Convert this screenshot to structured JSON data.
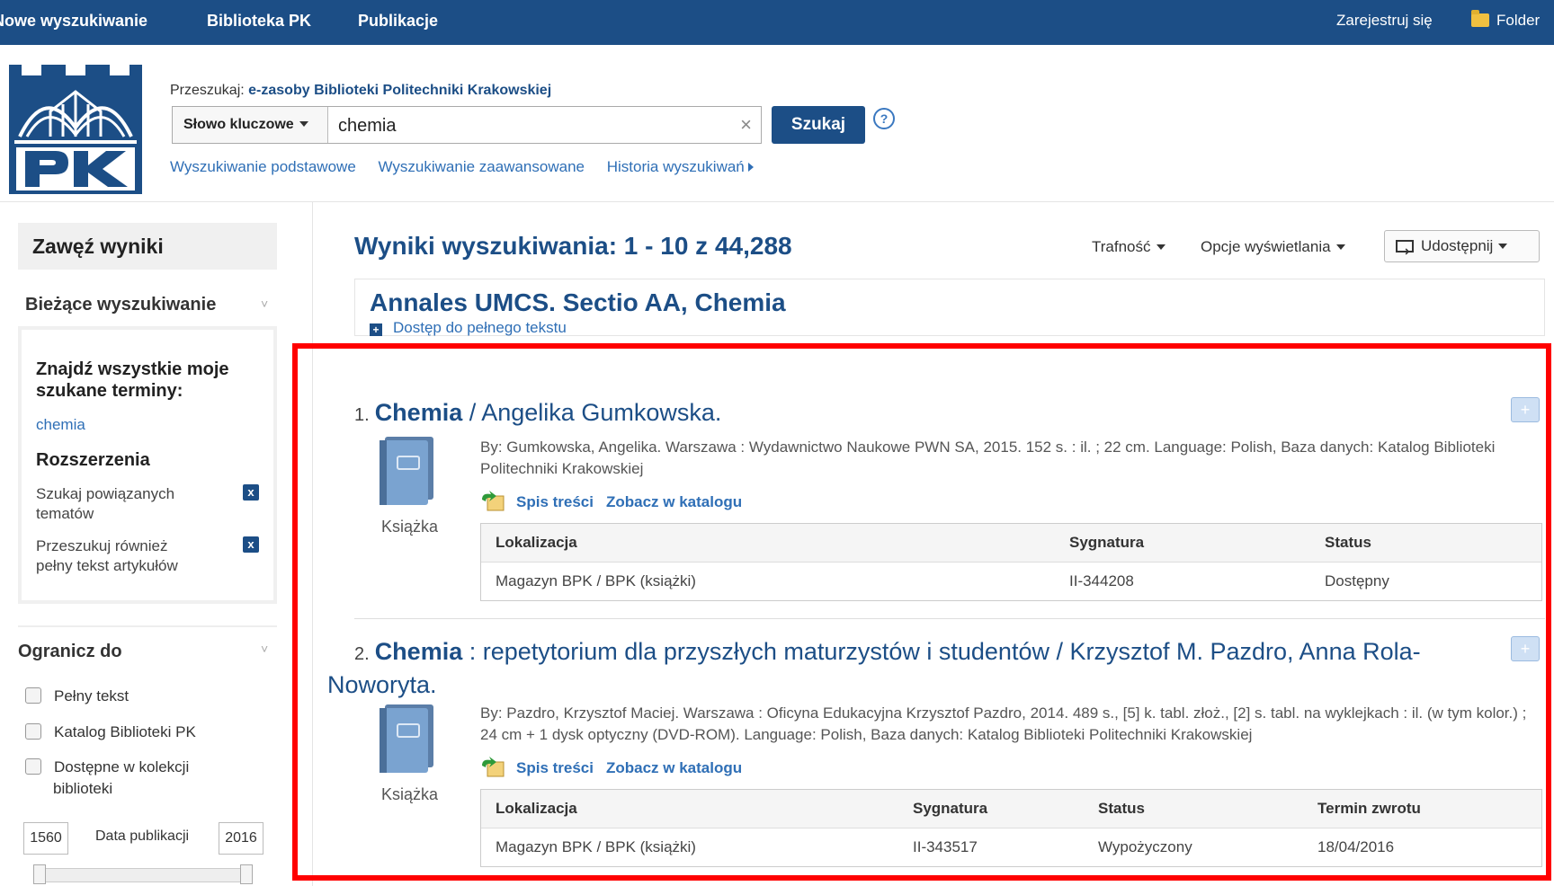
{
  "topbar": {
    "nav": [
      "Nowe wyszukiwanie",
      "Biblioteka PK",
      "Publikacje"
    ],
    "register": "Zarejestruj się",
    "folder": "Folder"
  },
  "search": {
    "label_prefix": "Przeszukaj:",
    "label_source": "e-zasoby Biblioteki Politechniki Krakowskiej",
    "field_select": "Słowo kluczowe",
    "query": "chemia",
    "clear": "×",
    "button": "Szukaj",
    "help": "?",
    "links": [
      "Wyszukiwanie podstawowe",
      "Wyszukiwanie zaawansowane",
      "Historia wyszukiwań"
    ]
  },
  "sidebar": {
    "title": "Zawęź wyniki",
    "current_title": "Bieżące wyszukiwanie",
    "find_all": "Znajdź wszystkie moje szukane terminy:",
    "term": "chemia",
    "extensions": "Rozszerzenia",
    "ext_options": [
      "Szukaj powiązanych tematów",
      "Przeszukuj również pełny tekst artykułów"
    ],
    "limit_title": "Ogranicz do",
    "limit_options": [
      "Pełny tekst",
      "Katalog Biblioteki PK",
      "Dostępne w kolekcji biblioteki"
    ],
    "date_from": "1560",
    "date_label": "Data publikacji",
    "date_to": "2016",
    "date_range_fraction": [
      0.0,
      1.0
    ]
  },
  "main": {
    "results_title": "Wyniki wyszukiwania: 1 - 10 z 44,288",
    "sort": "Trafność",
    "display_options": "Opcje wyświetlania",
    "share": "Udostępnij",
    "pub": {
      "title": "Annales UMCS. Sectio AA, Chemia",
      "link": "Dostęp do pełnego tekstu"
    },
    "results": [
      {
        "num": "1.",
        "title_strong": "Chemia",
        "title_rest": " / Angelika Gumkowska.",
        "type": "Książka",
        "desc": "By: Gumkowska, Angelika. Warszawa : Wydawnictwo Naukowe PWN SA, 2015. 152 s. : il. ; 22 cm. Language: Polish, Baza danych: Katalog Biblioteki Politechniki Krakowskiej",
        "toc": "Spis treści",
        "catalog": "Zobacz w katalogu",
        "headers": [
          "Lokalizacja",
          "Sygnatura",
          "Status"
        ],
        "row": [
          "Magazyn BPK / BPK (książki)",
          "II-344208",
          "Dostępny"
        ]
      },
      {
        "num": "2.",
        "title_strong": "Chemia",
        "title_rest": " : repetytorium dla przyszłych maturzystów i studentów / Krzysztof M. Pazdro, Anna Rola-Noworyta.",
        "type": "Książka",
        "desc": "By: Pazdro, Krzysztof Maciej. Warszawa : Oficyna Edukacyjna Krzysztof Pazdro, 2014. 489 s., [5] k. tabl. złoż., [2] s. tabl. na wyklejkach : il. (w tym kolor.) ; 24 cm + 1 dysk optyczny (DVD-ROM). Language: Polish, Baza danych: Katalog Biblioteki Politechniki Krakowskiej",
        "toc": "Spis treści",
        "catalog": "Zobacz w katalogu",
        "headers": [
          "Lokalizacja",
          "Sygnatura",
          "Status",
          "Termin zwrotu"
        ],
        "row": [
          "Magazyn BPK / BPK (książki)",
          "II-343517",
          "Wypożyczony",
          "18/04/2016"
        ]
      }
    ]
  },
  "colors": {
    "brand": "#1c4e86",
    "link": "#2f6fb6",
    "highlight": "#ff0000"
  }
}
